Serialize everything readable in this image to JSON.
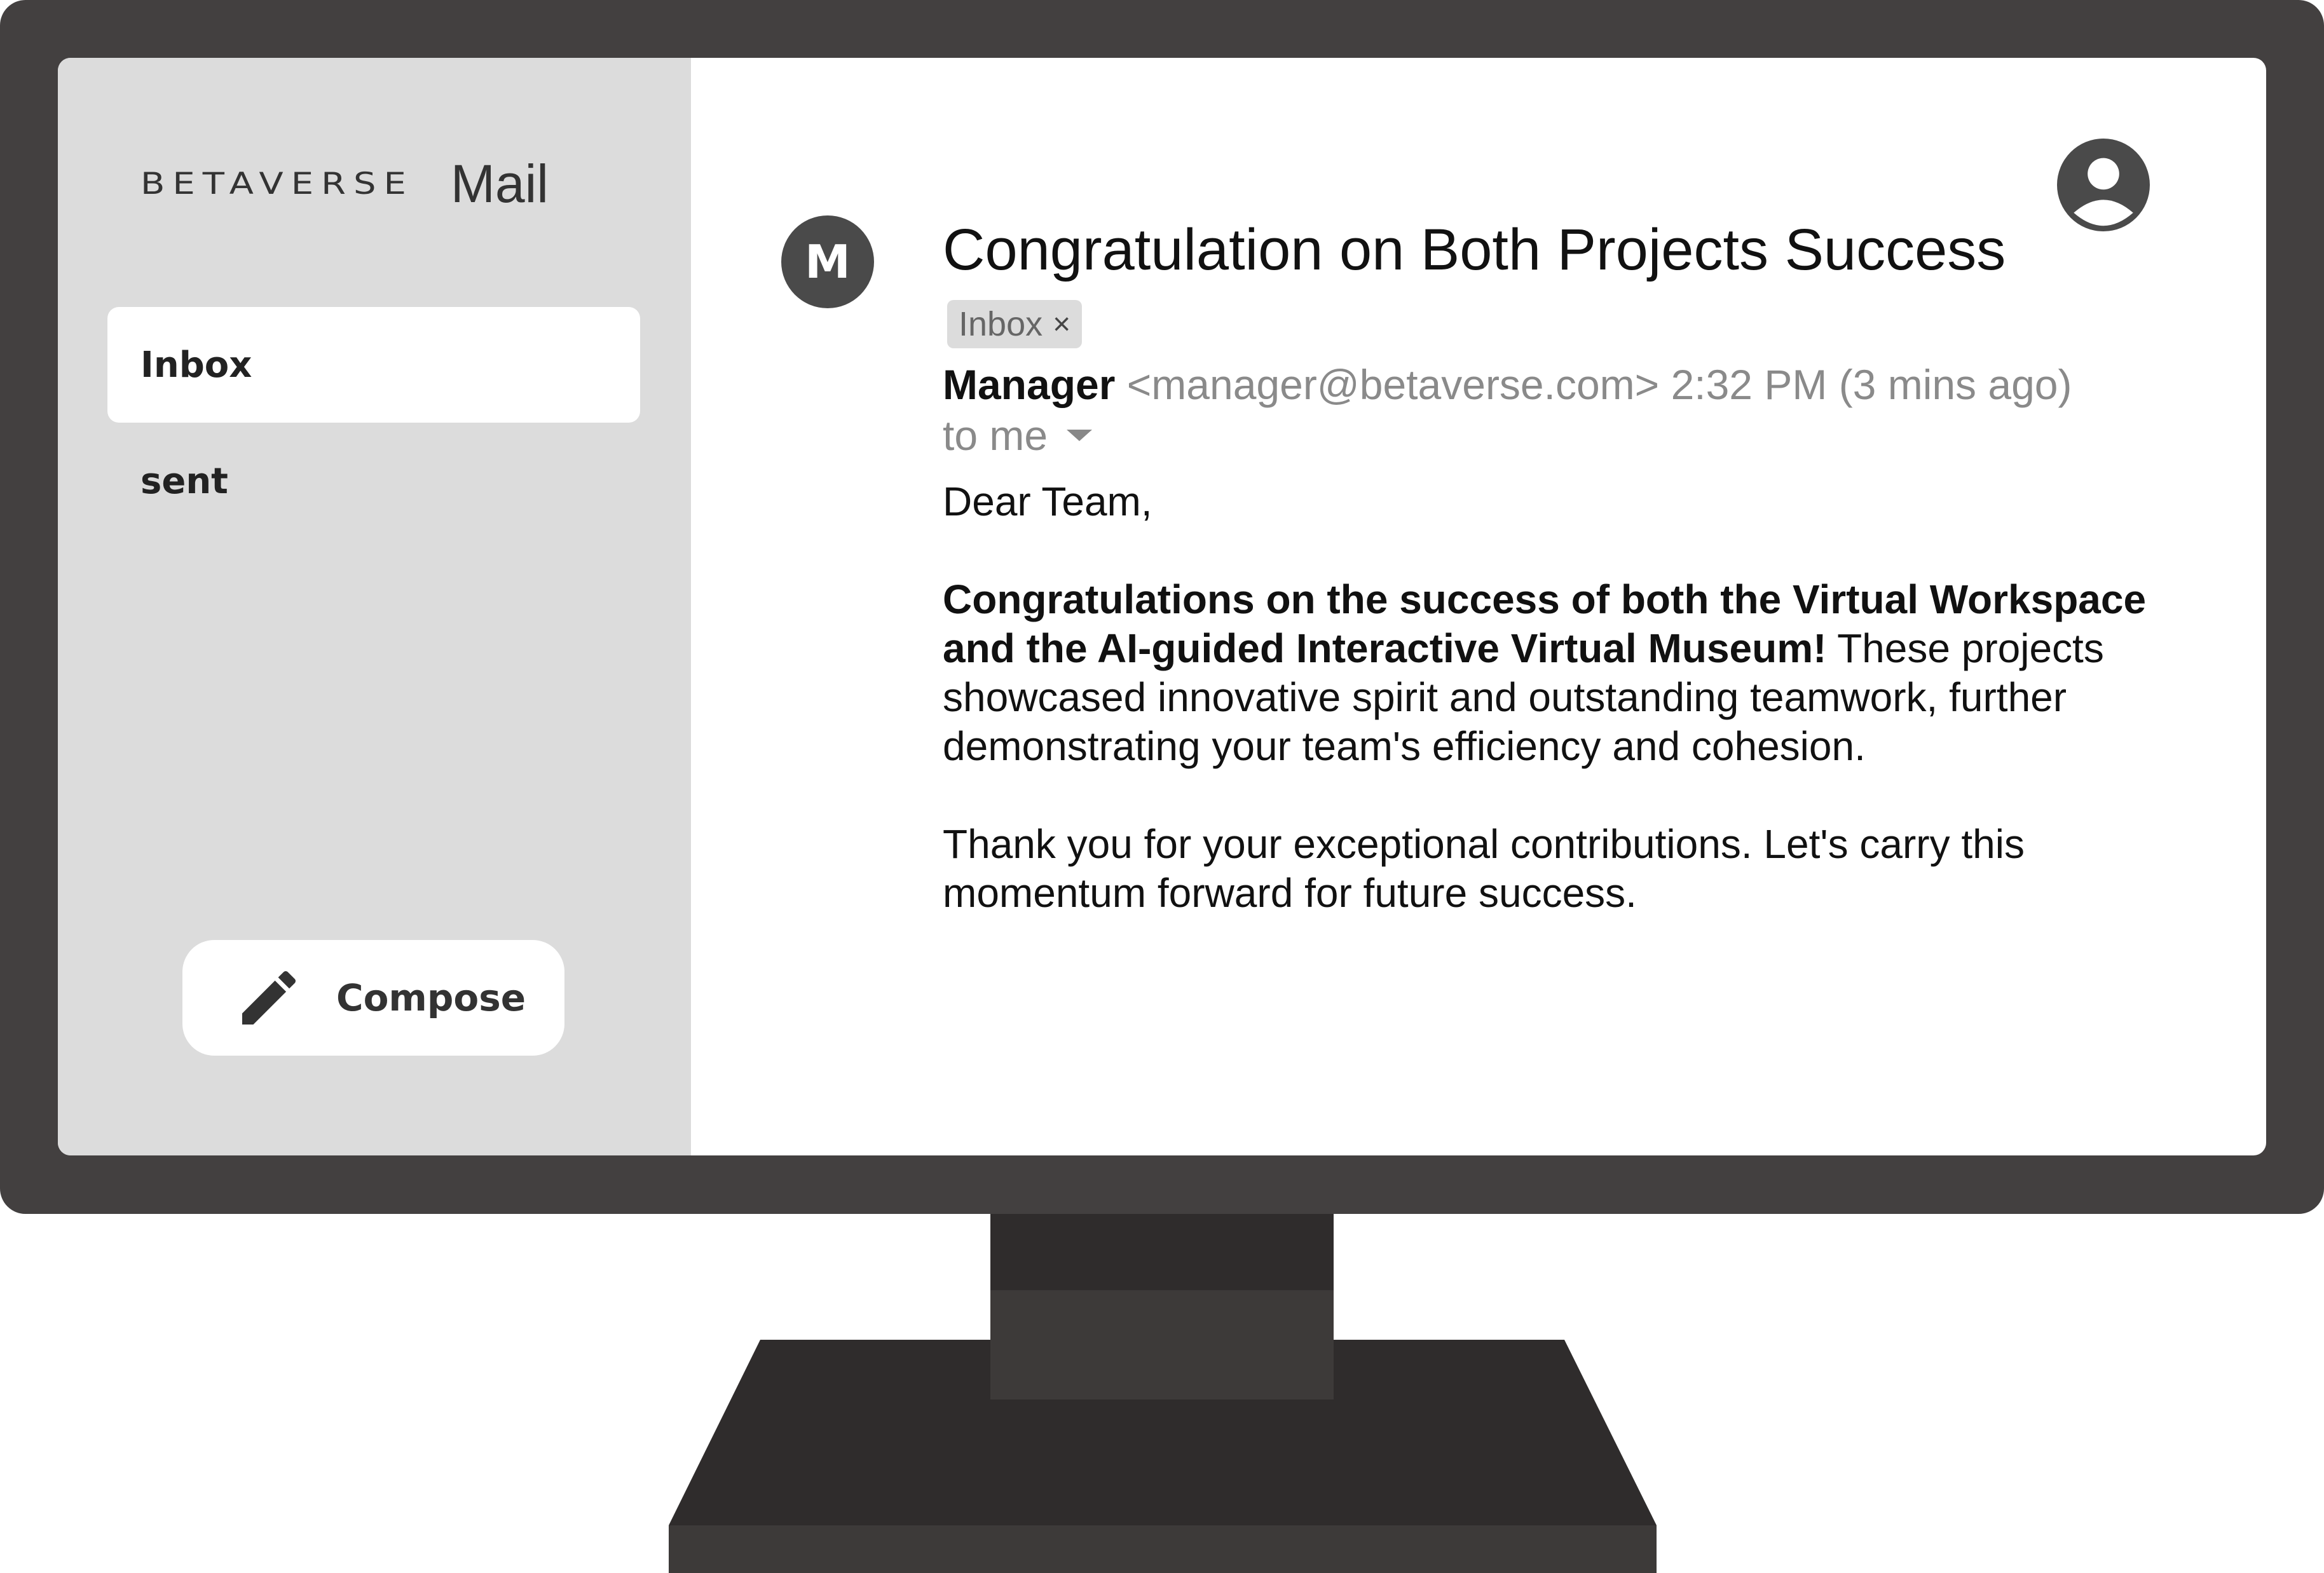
{
  "app": {
    "brand": "BETAVERSE",
    "product": "Mail"
  },
  "sidebar": {
    "items": [
      {
        "label": "Inbox",
        "active": true
      },
      {
        "label": "sent",
        "active": false
      }
    ],
    "compose_label": "Compose"
  },
  "email": {
    "sender_initial": "M",
    "subject": "Congratulation on Both Projects Success",
    "label_chip": "Inbox",
    "chip_remove": "×",
    "sender_name": "Manager",
    "sender_email": "<manager@betaverse.com>",
    "timestamp": "2:32 PM (3 mins ago)",
    "recipient": "to me",
    "greeting": "Dear Team,",
    "paragraph1_bold": "Congratulations on the success of both the Virtual Workspace and the AI-guided Interactive Virtual Museum!",
    "paragraph1_rest": " These projects showcased innovative spirit and outstanding teamwork, further demonstrating your team's efficiency and cohesion.",
    "paragraph2": "Thank you for your exceptional contributions. Let's carry this momentum forward for future success."
  },
  "colors": {
    "bezel": "#434040",
    "sidebar": "#dcdcdc",
    "avatar": "#4a4a4a",
    "muted_text": "#8a8a8a"
  },
  "icons": {
    "compose": "pencil-icon",
    "account": "account-circle-icon",
    "details": "caret-down-icon"
  }
}
